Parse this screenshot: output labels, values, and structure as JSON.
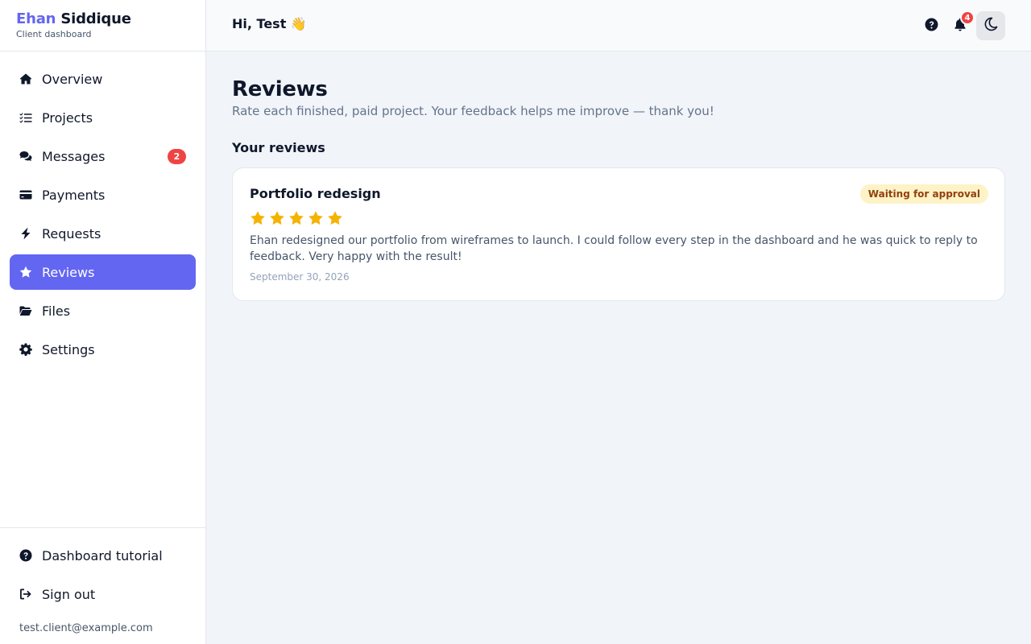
{
  "brand": {
    "first": "Ehan",
    "last": "Siddique",
    "subtitle": "Client dashboard"
  },
  "sidebar": {
    "items": [
      {
        "label": "Overview",
        "icon": "home-icon"
      },
      {
        "label": "Projects",
        "icon": "list-check-icon"
      },
      {
        "label": "Messages",
        "icon": "comments-icon",
        "badge": "2"
      },
      {
        "label": "Payments",
        "icon": "credit-card-icon"
      },
      {
        "label": "Requests",
        "icon": "bolt-icon"
      },
      {
        "label": "Reviews",
        "icon": "star-icon",
        "active": true
      },
      {
        "label": "Files",
        "icon": "folder-open-icon"
      },
      {
        "label": "Settings",
        "icon": "gear-icon"
      }
    ],
    "bottom": [
      {
        "label": "Dashboard tutorial",
        "icon": "question-circle-icon"
      },
      {
        "label": "Sign out",
        "icon": "sign-out-icon"
      }
    ],
    "user_email": "test.client@example.com"
  },
  "header": {
    "greeting": "Hi, Test 👋",
    "notification_count": "4",
    "icons": [
      "question-circle-icon",
      "bell-icon",
      "moon-icon"
    ]
  },
  "main": {
    "title": "Reviews",
    "subtitle": "Rate each finished, paid project. Your feedback helps me improve — thank you!",
    "section_title": "Your reviews",
    "reviews": [
      {
        "project": "Portfolio redesign",
        "status": "Waiting for approval",
        "rating": 5,
        "text": "Ehan redesigned our portfolio from wireframes to launch. I could follow every step in the dashboard and he was quick to reply to feedback. Very happy with the result!",
        "date": "September 30, 2026"
      }
    ]
  },
  "colors": {
    "accent": "#6366f1",
    "badge": "#ef4444",
    "star": "#f5b301",
    "pending_bg": "#fef3c7",
    "pending_text": "#92400e"
  }
}
